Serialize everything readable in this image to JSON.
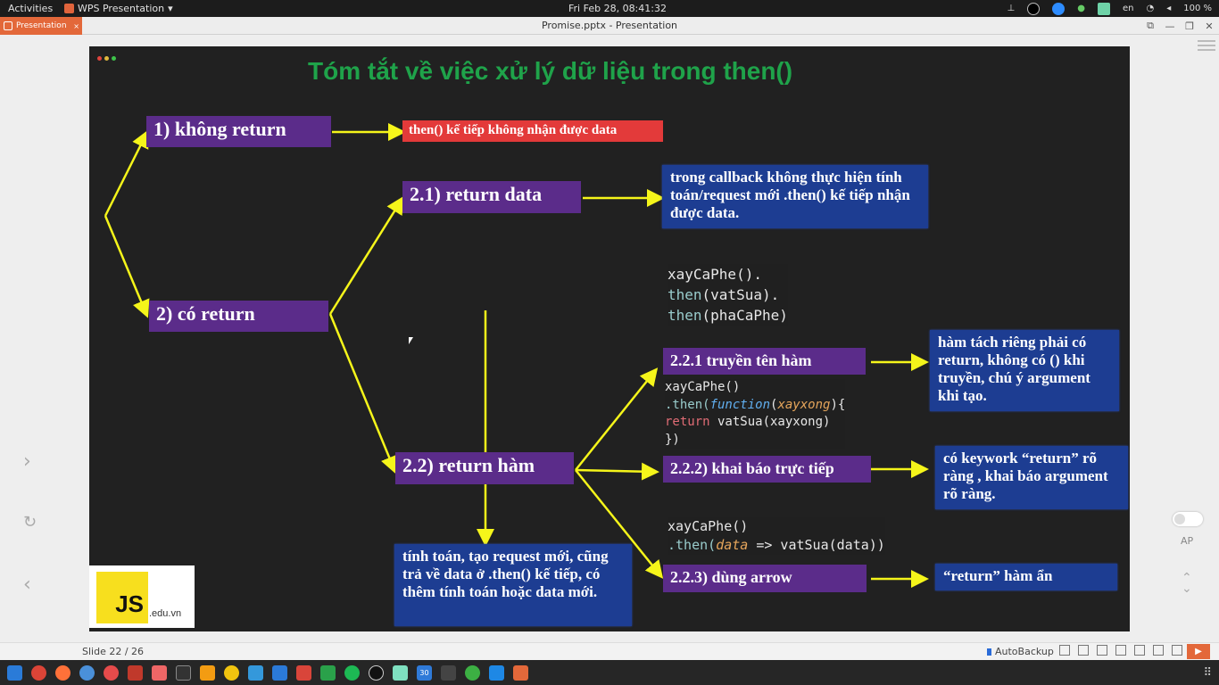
{
  "topbar": {
    "activities": "Activities",
    "app_name": "WPS Presentation",
    "app_caret": "▾",
    "clock": "Fri Feb 28, 08:41:32",
    "lang": "en",
    "battery": "100 %"
  },
  "window": {
    "tab_label": "Presentation",
    "tab_close": "×",
    "title": "Promise.pptx - Presentation",
    "controls": [
      "⧉",
      "—",
      "❐",
      "✕"
    ]
  },
  "slide": {
    "title": "Tóm tắt về việc xử lý dữ liệu trong then()",
    "no_return": "1) không return",
    "no_return_result": "then() kế tiếp không nhận được data",
    "has_return": "2) có return",
    "return_data": "2.1) return data",
    "return_data_result": "trong callback không thực hiện tính toán/request mới .then() kế tiếp nhận được data.",
    "return_func": "2.2) return hàm",
    "return_func_result": "tính toán, tạo request mới, cũng trả về data ở .then() kế tiếp, có thêm tính toán hoặc data mới.",
    "pass_name": "2.2.1 truyền tên hàm",
    "pass_name_result": "hàm tách riêng phải có return, không có () khi truyền, chú ý argument khi tạo.",
    "declare": "2.2.2) khai báo trực tiếp",
    "declare_result": "có keywork “return” rõ ràng , khai báo argument rõ ràng.",
    "arrow": "2.2.3) dùng arrow",
    "arrow_result": "“return” hàm ẩn",
    "code1": {
      "l1": "xayCaPhe().",
      "l2a": "then",
      "l2b": "(vatSua).",
      "l3a": "then",
      "l3b": "(phaCaPhe)"
    },
    "code2": {
      "l1": "xayCaPhe()",
      "l2a": ".then(",
      "l2b": "function",
      "l2c": "(",
      "l2d": "xayxong",
      "l2e": "){",
      "l3a": "return",
      "l3b": " vatSua(xayxong)",
      "l4": "})"
    },
    "code3": {
      "l1": "xayCaPhe()",
      "l2a": ".then(",
      "l2b": "data",
      "l2c": " => vatSua(data))"
    },
    "logo_js": "JS",
    "logo_edu": ".edu.vn"
  },
  "side": {
    "ap": "AP"
  },
  "status": {
    "slide_no": "Slide 22 / 26",
    "autobackup": "AutoBackup",
    "play": "▶"
  },
  "taskbar": {
    "apps": [
      "grid",
      "chrome",
      "firefox",
      "files",
      "music",
      "mail",
      "photos",
      "terminal",
      "sublime",
      "finder",
      "folder",
      "wps-writer",
      "wps-pdf",
      "wps-sheet",
      "spotify",
      "obs",
      "desktop",
      "calendar",
      "feather",
      "shield",
      "vscode",
      "wps-pres"
    ],
    "calendar_day": "30",
    "grid_icon": "⠿"
  },
  "colors": {
    "slide_bg": "#212121",
    "title_green": "#1fa34a",
    "purple": "#5b2c8a",
    "blue": "#1d3d92",
    "red": "#e33a3a",
    "arrow_yellow": "#f5f51a",
    "accent_orange": "#e3683a"
  }
}
